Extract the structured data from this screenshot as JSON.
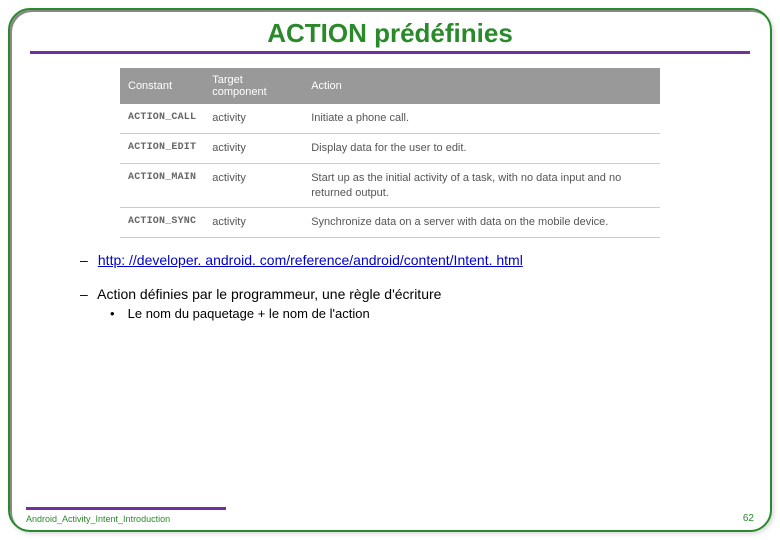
{
  "title": "ACTION prédéfinies",
  "table": {
    "headers": [
      "Constant",
      "Target component",
      "Action"
    ],
    "rows": [
      {
        "c": "ACTION_CALL",
        "t": "activity",
        "a": "Initiate a phone call."
      },
      {
        "c": "ACTION_EDIT",
        "t": "activity",
        "a": "Display data for the user to edit."
      },
      {
        "c": "ACTION_MAIN",
        "t": "activity",
        "a": "Start up as the initial activity of a task, with no data input and no returned output."
      },
      {
        "c": "ACTION_SYNC",
        "t": "activity",
        "a": "Synchronize data on a server with data on the mobile device."
      }
    ]
  },
  "bullets": {
    "link_text": "http: //developer. android. com/reference/android/content/Intent. html",
    "rule_text": "Action définies par le programmeur, une règle d'écriture",
    "sub_text": "Le nom du paquetage + le nom de l'action"
  },
  "footer": "Android_Activity_Intent_Introduction",
  "page": "62"
}
